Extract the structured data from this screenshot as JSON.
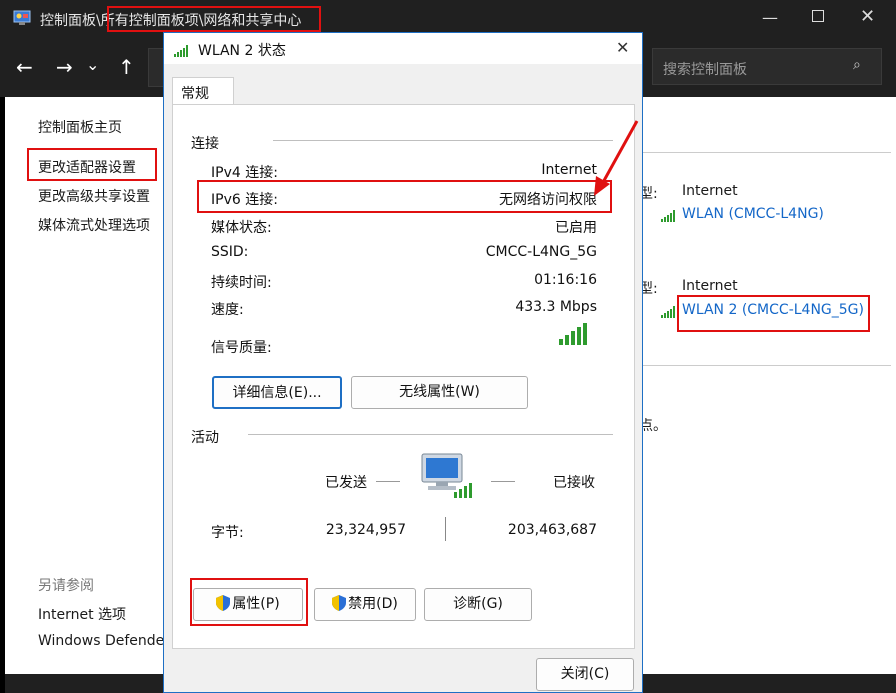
{
  "window": {
    "breadcrumb_prefix": "控制面板\\",
    "breadcrumb_rest": "所有控制面板项\\网络和共享中心",
    "search_placeholder": "搜索控制面板"
  },
  "sidebar": {
    "home": "控制面板主页",
    "adapter": "更改适配器设置",
    "advanced": "更改高级共享设置",
    "media": "媒体流式处理选项",
    "see_also": "另请参阅",
    "internet_options": "Internet 选项",
    "defender": "Windows Defende"
  },
  "networks": [
    {
      "type_label": "型:",
      "access": "Internet",
      "connection": "WLAN (CMCC-L4NG)"
    },
    {
      "type_label": "型:",
      "access": "Internet",
      "connection": "WLAN 2 (CMCC-L4NG_5G)"
    }
  ],
  "bg_text": "点。",
  "dialog": {
    "title": "WLAN 2 状态",
    "tab": "常规",
    "section_connection": "连接",
    "rows": [
      {
        "label": "IPv4 连接:",
        "value": "Internet"
      },
      {
        "label": "IPv6 连接:",
        "value": "无网络访问权限"
      },
      {
        "label": "媒体状态:",
        "value": "已启用"
      },
      {
        "label": "SSID:",
        "value": "CMCC-L4NG_5G"
      },
      {
        "label": "持续时间:",
        "value": "01:16:16"
      },
      {
        "label": "速度:",
        "value": "433.3 Mbps"
      },
      {
        "label": "信号质量:",
        "value": ""
      }
    ],
    "details_button": "详细信息(E)...",
    "wireless_button": "无线属性(W)",
    "section_activity": "活动",
    "sent": "已发送",
    "received": "已接收",
    "bytes_label": "字节:",
    "bytes_sent": "23,324,957",
    "bytes_received": "203,463,687",
    "properties_button": "属性(P)",
    "disable_button": "禁用(D)",
    "diagnose_button": "诊断(G)",
    "close_button": "关闭(C)"
  },
  "colors": {
    "accent": "#1e6fc4",
    "highlight": "#e01010",
    "signal": "#2e9b2e",
    "link": "#1467c8"
  }
}
